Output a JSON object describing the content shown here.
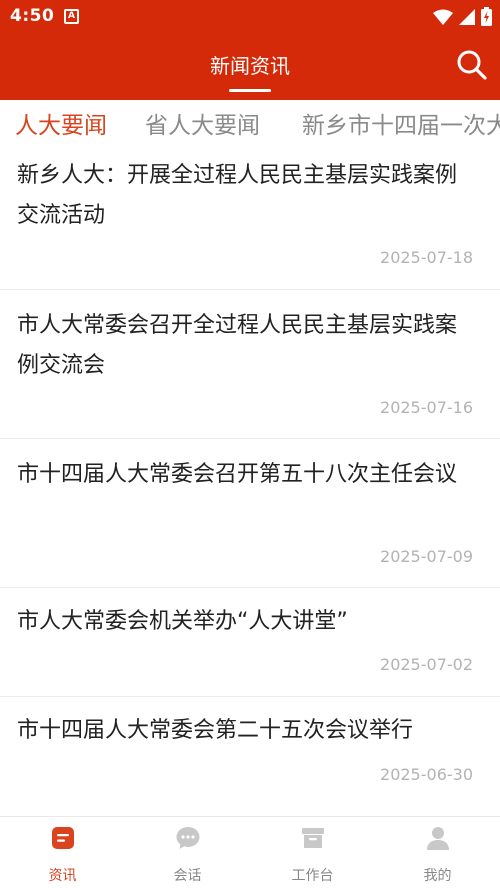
{
  "status_bar": {
    "time": "4:50",
    "notification_badge": "A"
  },
  "header": {
    "title": "新闻资讯",
    "accent_color": "#d42a0a"
  },
  "tabs": [
    {
      "label": "人大要闻",
      "active": true
    },
    {
      "label": "省人大要闻",
      "active": false
    },
    {
      "label": "新乡市十四届一次大",
      "active": false
    }
  ],
  "news": [
    {
      "title": "新乡人大：开展全过程人民民主基层实践案例交流活动",
      "date": "2025-07-18"
    },
    {
      "title": "市人大常委会召开全过程人民民主基层实践案例交流会",
      "date": "2025-07-16"
    },
    {
      "title": "市十四届人大常委会召开第五十八次主任会议",
      "date": "2025-07-09"
    },
    {
      "title": "市人大常委会机关举办“人大讲堂”",
      "date": "2025-07-02"
    },
    {
      "title": "市十四届人大常委会第二十五次会议举行",
      "date": "2025-06-30"
    }
  ],
  "bottom_nav": [
    {
      "label": "资讯",
      "icon": "news-icon",
      "active": true
    },
    {
      "label": "会话",
      "icon": "chat-icon",
      "active": false
    },
    {
      "label": "工作台",
      "icon": "workbench-icon",
      "active": false
    },
    {
      "label": "我的",
      "icon": "profile-icon",
      "active": false
    }
  ]
}
